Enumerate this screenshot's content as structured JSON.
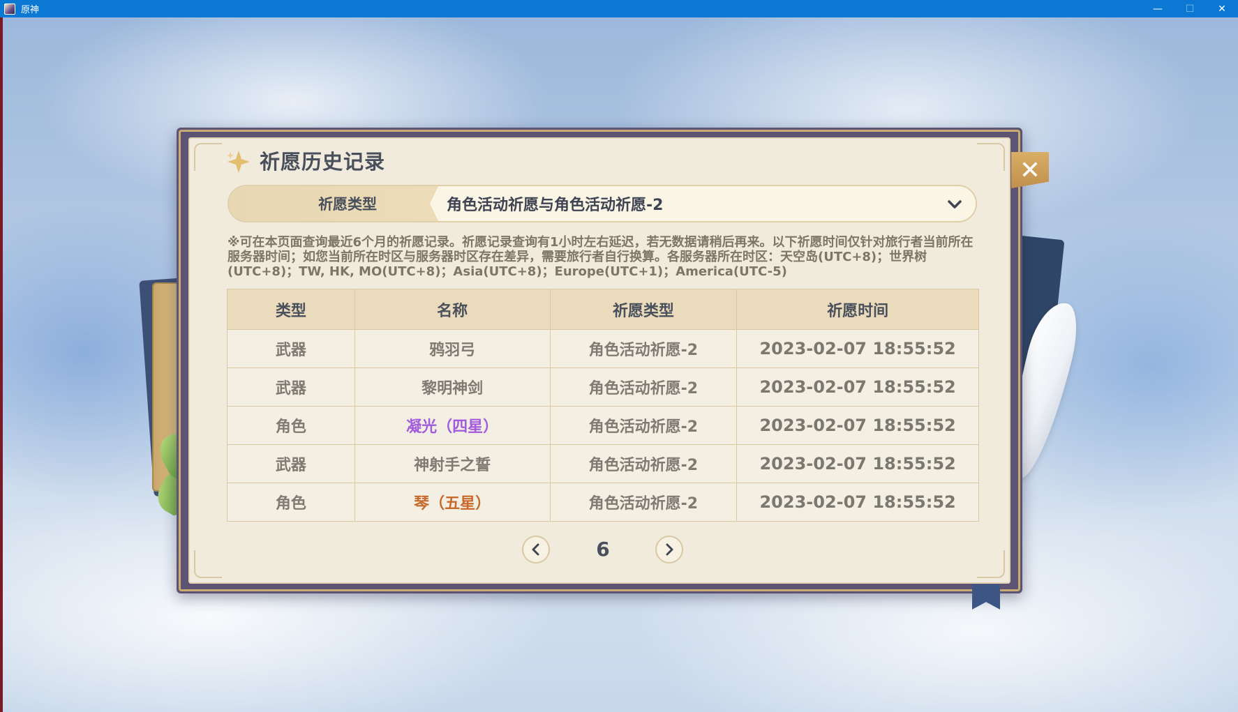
{
  "window": {
    "title": "原神",
    "controls": {
      "minimize": "—",
      "maximize": "☐",
      "close": "✕"
    }
  },
  "panel": {
    "title": "祈愿历史记录",
    "close_label": "✕",
    "selector": {
      "label": "祈愿类型",
      "value": "角色活动祈愿与角色活动祈愿-2"
    },
    "notice": "※可在本页面查询最近6个月的祈愿记录。祈愿记录查询有1小时左右延迟，若无数据请稍后再来。以下祈愿时间仅针对旅行者当前所在服务器时间；如您当前所在时区与服务器时区存在差异，需要旅行者自行换算。各服务器所在时区：天空岛(UTC+8)；世界树(UTC+8)；TW, HK, MO(UTC+8)；Asia(UTC+8)；Europe(UTC+1)；America(UTC-5)",
    "table": {
      "headers": [
        "类型",
        "名称",
        "祈愿类型",
        "祈愿时间"
      ],
      "rows": [
        {
          "type": "武器",
          "name": "鸦羽弓",
          "wish": "角色活动祈愿-2",
          "time": "2023-02-07 18:55:52",
          "color": "#7f7a72"
        },
        {
          "type": "武器",
          "name": "黎明神剑",
          "wish": "角色活动祈愿-2",
          "time": "2023-02-07 18:55:52",
          "color": "#7f7a72"
        },
        {
          "type": "角色",
          "name": "凝光（四星）",
          "wish": "角色活动祈愿-2",
          "time": "2023-02-07 18:55:52",
          "color": "#a25bdc"
        },
        {
          "type": "武器",
          "name": "神射手之誓",
          "wish": "角色活动祈愿-2",
          "time": "2023-02-07 18:55:52",
          "color": "#7f7a72"
        },
        {
          "type": "角色",
          "name": "琴（五星）",
          "wish": "角色活动祈愿-2",
          "time": "2023-02-07 18:55:52",
          "color": "#c8692c"
        }
      ]
    },
    "pagination": {
      "page": "6"
    }
  },
  "colors": {
    "four_star": "#a25bdc",
    "five_star": "#c8692c",
    "header_bg": "#e9dbbc",
    "panel_bg": "#f1ebdd"
  },
  "icons": {
    "star": "sparkle-star-icon",
    "chevron": "chevron-down-icon",
    "prev": "chevron-left-icon",
    "next": "chevron-right-icon",
    "close": "close-icon"
  }
}
